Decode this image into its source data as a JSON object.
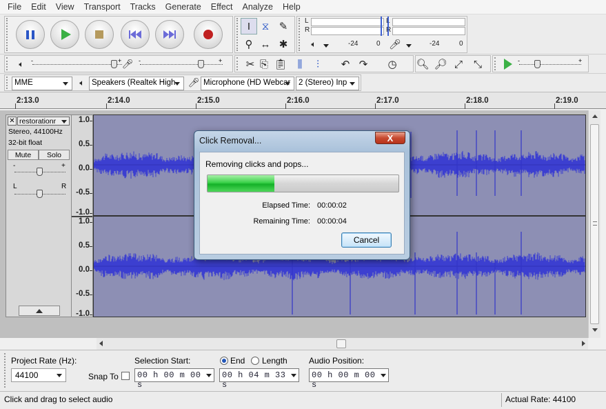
{
  "menu": [
    "File",
    "Edit",
    "View",
    "Transport",
    "Tracks",
    "Generate",
    "Effect",
    "Analyze",
    "Help"
  ],
  "meters": {
    "record": {
      "left_label": "L",
      "right_label": "R",
      "ticks": [
        "-24",
        "0"
      ]
    },
    "playback": {
      "left_label": "L",
      "right_label": "R",
      "ticks": [
        "-24",
        "0"
      ]
    }
  },
  "devices": {
    "host": "MME",
    "output": "Speakers (Realtek High",
    "input": "Microphone (HD Webcar",
    "channels": "2 (Stereo) Inp"
  },
  "ruler": {
    "labels": [
      "2:13.0",
      "2:14.0",
      "2:15.0",
      "2:16.0",
      "2:17.0",
      "2:18.0",
      "2:19.0"
    ]
  },
  "track": {
    "name": "restorationr",
    "info_line1": "Stereo, 44100Hz",
    "info_line2": "32-bit float",
    "mute": "Mute",
    "solo": "Solo",
    "pan_left": "L",
    "pan_right": "R",
    "gain_minus": "-",
    "gain_plus": "+"
  },
  "scale": [
    "1.0",
    "0.5",
    "0.0",
    "-0.5",
    "-1.0"
  ],
  "dialog": {
    "title": "Click Removal...",
    "message": "Removing clicks and pops...",
    "progress": 0.35,
    "elapsed_label": "Elapsed Time:",
    "elapsed_value": "00:00:02",
    "remaining_label": "Remaining Time:",
    "remaining_value": "00:00:04",
    "cancel": "Cancel",
    "close": "X"
  },
  "selection": {
    "project_rate_label": "Project Rate (Hz):",
    "project_rate": "44100",
    "snap_to": "Snap To",
    "selection_start_label": "Selection Start:",
    "end_label": "End",
    "length_label": "Length",
    "audio_position_label": "Audio Position:",
    "start_value": "00 h 00 m 00 s",
    "end_value": "00 h 04 m 33 s",
    "audio_position_value": "00 h 00 m 00 s"
  },
  "status": {
    "left": "Click and drag to select audio",
    "right": "Actual Rate: 44100"
  },
  "colors": {
    "waveform": "#3c3fd0",
    "wave_bg": "#8d8fb4",
    "progress": "#22c030"
  }
}
